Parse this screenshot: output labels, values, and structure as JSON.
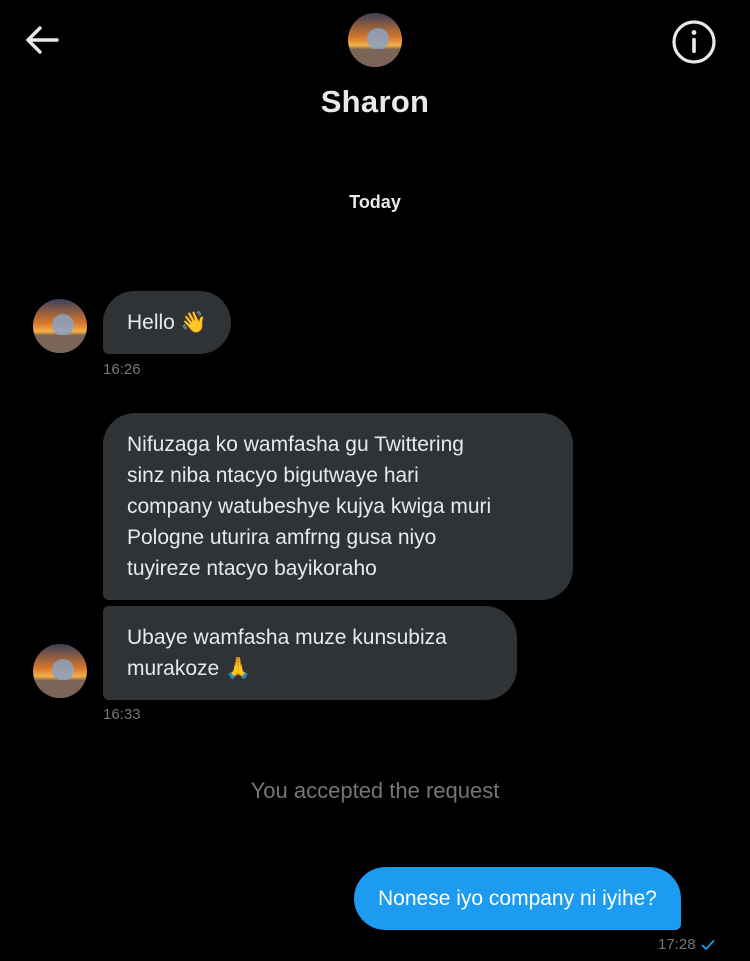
{
  "header": {
    "back_icon": "arrow-left-icon",
    "info_icon": "info-circle-icon",
    "contact_name": "Sharon"
  },
  "conversation": {
    "date_divider": "Today",
    "incoming": [
      {
        "text": "Hello 👋",
        "time": "16:26"
      },
      {
        "text": "Nifuzaga ko wamfasha gu Twittering\nsinz niba ntacyo bigutwaye hari\ncompany watubeshye kujya kwiga muri\nPologne uturira amfrng gusa niyo\ntuyireze ntacyo bayikoraho",
        "time": ""
      },
      {
        "text": "Ubaye wamfasha muze kunsubiza\nmurakoze 🙏",
        "time": "16:33"
      }
    ],
    "system_message": "You accepted the request",
    "outgoing": [
      {
        "text": "Nonese iyo company ni iyihe?",
        "time": "17:28",
        "status_icon": "check-icon"
      }
    ]
  },
  "colors": {
    "background": "#000000",
    "incoming_bubble": "#2f3336",
    "outgoing_bubble": "#1d9bf0",
    "muted_text": "#71767b"
  }
}
